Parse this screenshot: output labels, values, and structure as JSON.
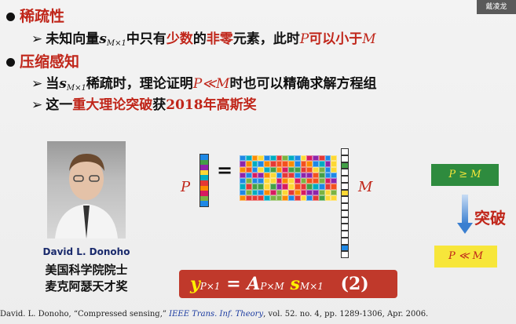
{
  "badge": {
    "text": "戴凌龙"
  },
  "bullets": [
    {
      "title": "稀疏性",
      "sub": {
        "a": "未知向量",
        "s": "s",
        "m": "M×1",
        "b": "中只有",
        "red1": "少数",
        "c": "的",
        "red2": "非零",
        "d": "元素，此时",
        "p": "P",
        "e": "可以小于",
        "mm": "M"
      }
    },
    {
      "title": "压缩感知",
      "sub1": {
        "a": "当",
        "s": "s",
        "m": "M×1",
        "b": "稀疏时，理论证明",
        "pm": "P≪M",
        "c": "时也可以精确求解方程组"
      },
      "sub2": {
        "a": "这一",
        "red": "重大理论突破",
        "b": "获",
        "red2": "2018年高斯奖"
      }
    }
  ],
  "person": {
    "name": "David L. Donoho",
    "line1": "美国科学院院士",
    "line2": "麦克阿瑟天才奖"
  },
  "matrix": {
    "p_label": "P",
    "eq": "=",
    "m_label": "M"
  },
  "equation": {
    "y": "y",
    "ysub": "P×1",
    "eq": "=",
    "a": "A",
    "asub": "P×M",
    "s": "s",
    "ssub": "M×1",
    "num": "(2)"
  },
  "right": {
    "top": "P ≥ M",
    "mid": "突破",
    "bottom": "P ≪ M"
  },
  "citation": {
    "pre": "David. L. Donoho, “Compressed sensing,” ",
    "journal": "IEEE Trans. Inf. Theory",
    "post": ", vol. 52. no. 4, pp. 1289-1306, Apr. 2006."
  },
  "colors": {
    "red": "#c0261a",
    "green": "#2e8b3e",
    "yellow": "#f7e63a",
    "eqbg": "#c0392b",
    "arrow": "#4a90d9"
  }
}
